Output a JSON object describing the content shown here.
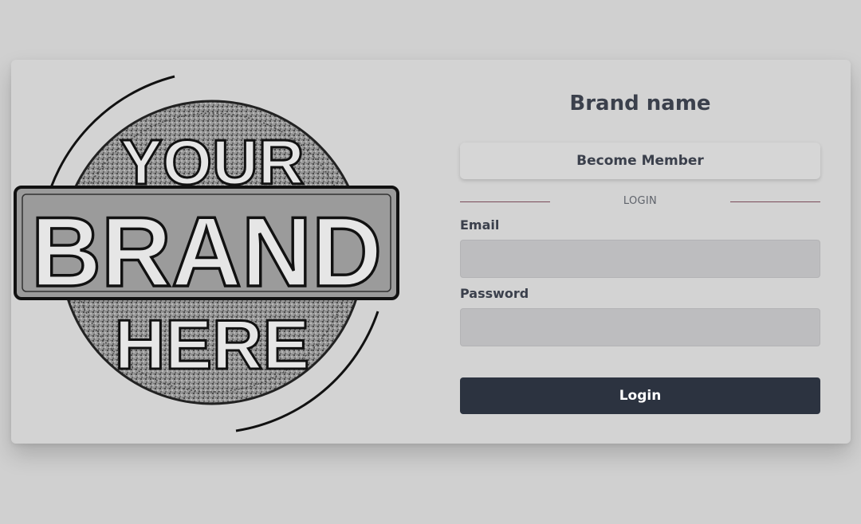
{
  "logo": {
    "line1": "YOUR",
    "line2": "BRAND",
    "line3": "HERE"
  },
  "form": {
    "brand_name": "Brand name",
    "become_member_label": "Become Member",
    "divider_label": "LOGIN",
    "email_label": "Email",
    "email_value": "",
    "password_label": "Password",
    "password_value": "",
    "login_label": "Login"
  },
  "colors": {
    "background": "#d0d0d0",
    "card": "#d3d3d3",
    "text": "#3b404c",
    "input_bg": "#bdbdbf",
    "primary_button": "#2c3340",
    "divider_line": "#7a4a58"
  }
}
